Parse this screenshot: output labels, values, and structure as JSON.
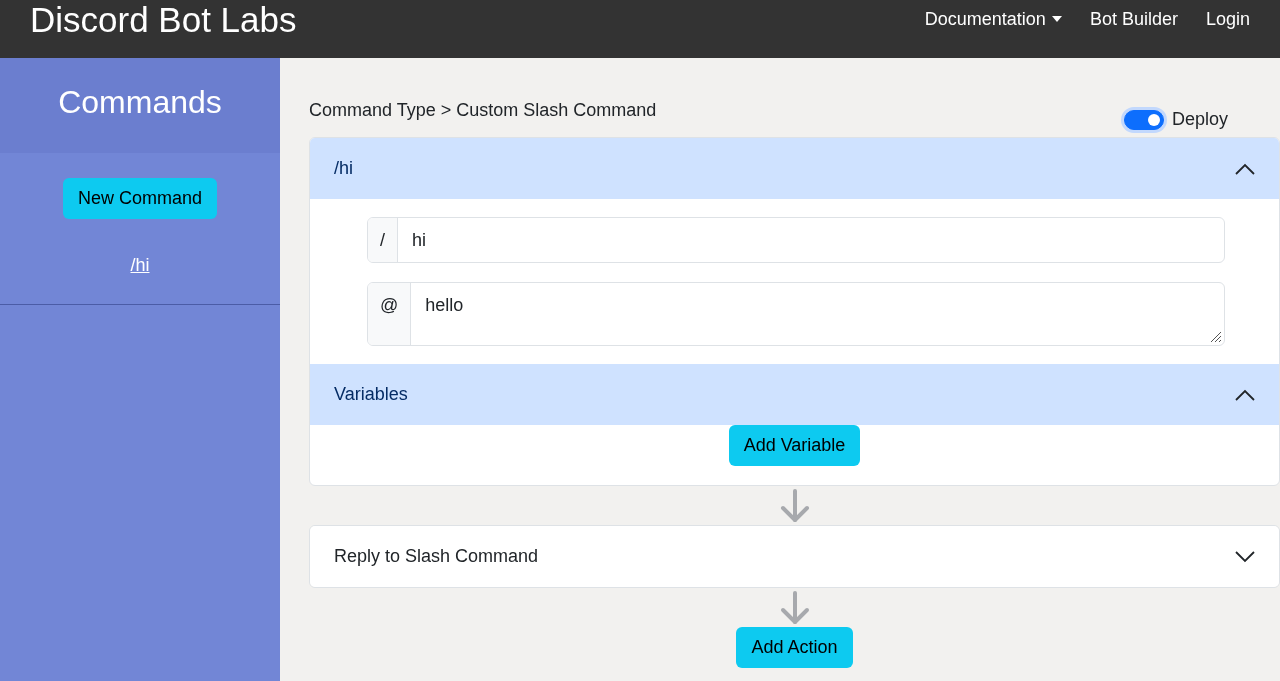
{
  "navbar": {
    "brand": "Discord Bot Labs",
    "links": [
      {
        "label": "Documentation",
        "dropdown": true
      },
      {
        "label": "Bot Builder",
        "dropdown": false
      },
      {
        "label": "Login",
        "dropdown": false
      }
    ]
  },
  "sidebar": {
    "title": "Commands",
    "new_button": "New Command",
    "commands": [
      "/hi"
    ]
  },
  "breadcrumb": "Command Type > Custom Slash Command",
  "deploy": {
    "label": "Deploy",
    "on": true
  },
  "command_panel": {
    "title": "/hi",
    "expanded": true,
    "name_prefix": "/",
    "name_value": "hi",
    "description_prefix": "@",
    "description_value": "hello"
  },
  "variables_panel": {
    "title": "Variables",
    "expanded": true,
    "button": "Add Variable"
  },
  "actions": [
    {
      "title": "Reply to Slash Command",
      "expanded": false
    }
  ],
  "add_action_button": "Add Action"
}
